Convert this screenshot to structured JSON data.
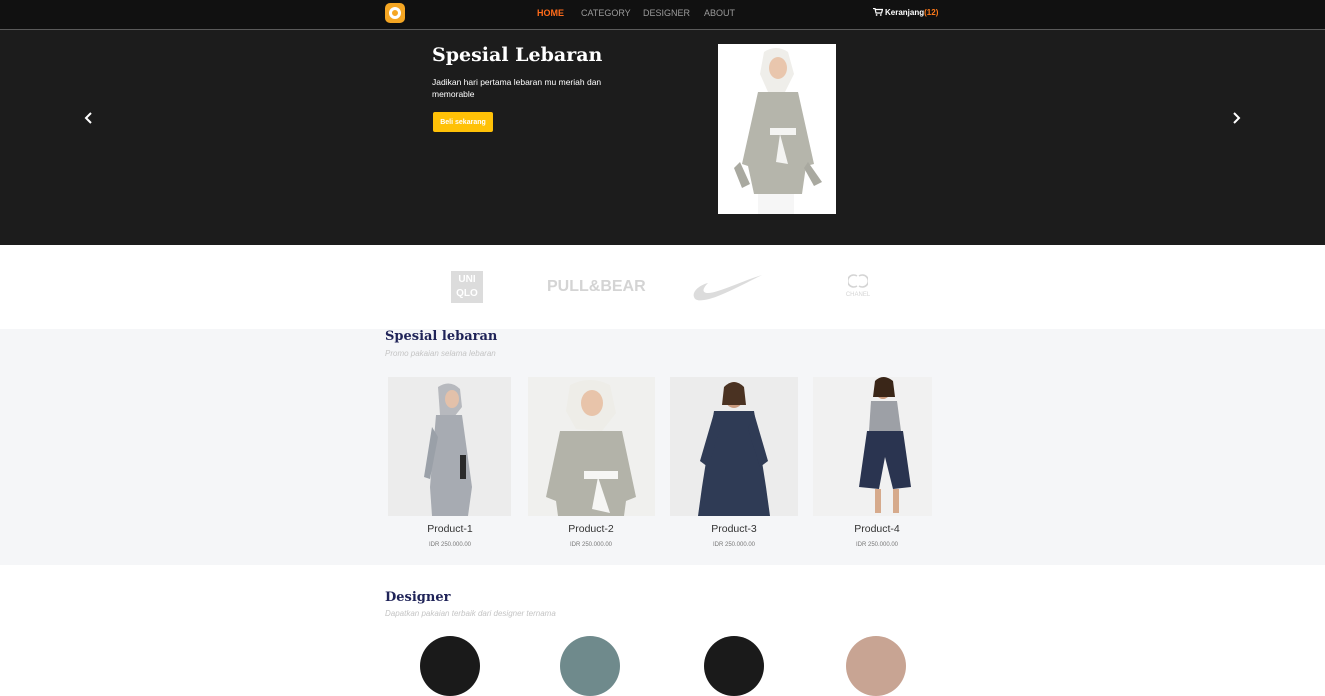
{
  "navbar": {
    "links": [
      {
        "label": "HOME",
        "active": true
      },
      {
        "label": "CATEGORY",
        "active": false
      },
      {
        "label": "DESIGNER",
        "active": false
      },
      {
        "label": "ABOUT",
        "active": false
      }
    ],
    "cart": {
      "label": "Keranjang",
      "count": "(12)",
      "icon": "cart-icon"
    },
    "logo_icon": "logo-ring-icon",
    "accent_color": "#ff6b1a"
  },
  "hero": {
    "title": "Spesial Lebaran",
    "text": "Jadikan hari pertama lebaran mu meriah dan memorable",
    "button_label": "Beli sekarang",
    "button_color": "#ffc107",
    "prev_icon": "chevron-left-icon",
    "next_icon": "chevron-right-icon"
  },
  "brands": [
    {
      "name": "UNIQLO",
      "lines": [
        "UNI",
        "QLO"
      ]
    },
    {
      "name": "PULL&BEAR"
    },
    {
      "name": "Nike swoosh"
    },
    {
      "name": "CHANEL"
    }
  ],
  "special": {
    "title": "Spesial lebaran",
    "subtitle": "Promo pakaian selama lebaran",
    "products": [
      {
        "name": "Product-1",
        "price": "IDR 250.000.00"
      },
      {
        "name": "Product-2",
        "price": "IDR 250.000.00"
      },
      {
        "name": "Product-3",
        "price": "IDR 250.000.00"
      },
      {
        "name": "Product-4",
        "price": "IDR 250.000.00"
      }
    ]
  },
  "designer": {
    "title": "Designer",
    "subtitle": "Dapatkan pakaian terbaik dari designer ternama"
  }
}
